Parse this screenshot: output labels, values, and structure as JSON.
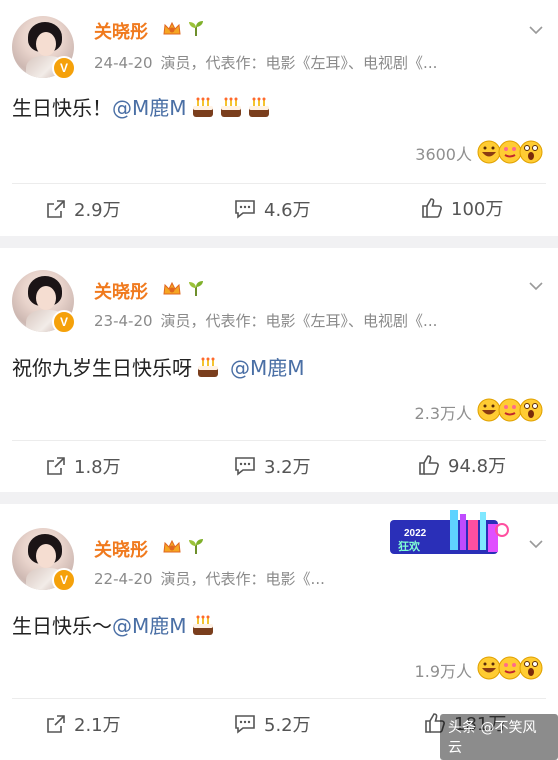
{
  "posts": [
    {
      "author": "关晓彤",
      "date": "24-4-20",
      "meta": "演员，代表作：电影《左耳》、电视剧《...",
      "text": "生日快乐！",
      "mention": "@M鹿M",
      "cakes": 3,
      "reaction_count": "3600人",
      "reposts": "2.9万",
      "comments": "4.6万",
      "likes": "100万"
    },
    {
      "author": "关晓彤",
      "date": "23-4-20",
      "meta": "演员，代表作：电影《左耳》、电视剧《...",
      "text": "祝你九岁生日快乐呀",
      "mention": "@M鹿M",
      "cakes": 1,
      "reaction_count": "2.3万人",
      "reposts": "1.8万",
      "comments": "3.2万",
      "likes": "94.8万"
    },
    {
      "author": "关晓彤",
      "date": "22-4-20",
      "meta": "演员，代表作：电影《...",
      "text": "生日快乐～",
      "mention": "@M鹿M",
      "cakes": 1,
      "reaction_count": "1.9万人",
      "reposts": "2.1万",
      "comments": "5.2万",
      "likes": "181万"
    }
  ],
  "banner": {
    "year": "2022",
    "label": "狂欢"
  },
  "watermark": "头条 @不笑风云",
  "colors": {
    "name": "#f07a1e",
    "mention": "#4a6fa5",
    "meta": "#8a8a8a",
    "separator": "#f1f1f3",
    "vip_badge": "#f5a10a"
  },
  "icons": [
    "repost-icon",
    "comment-icon",
    "like-icon",
    "chevron-down-icon",
    "crown-icon",
    "sprout-icon",
    "cake-icon",
    "reaction-faces-icon"
  ]
}
